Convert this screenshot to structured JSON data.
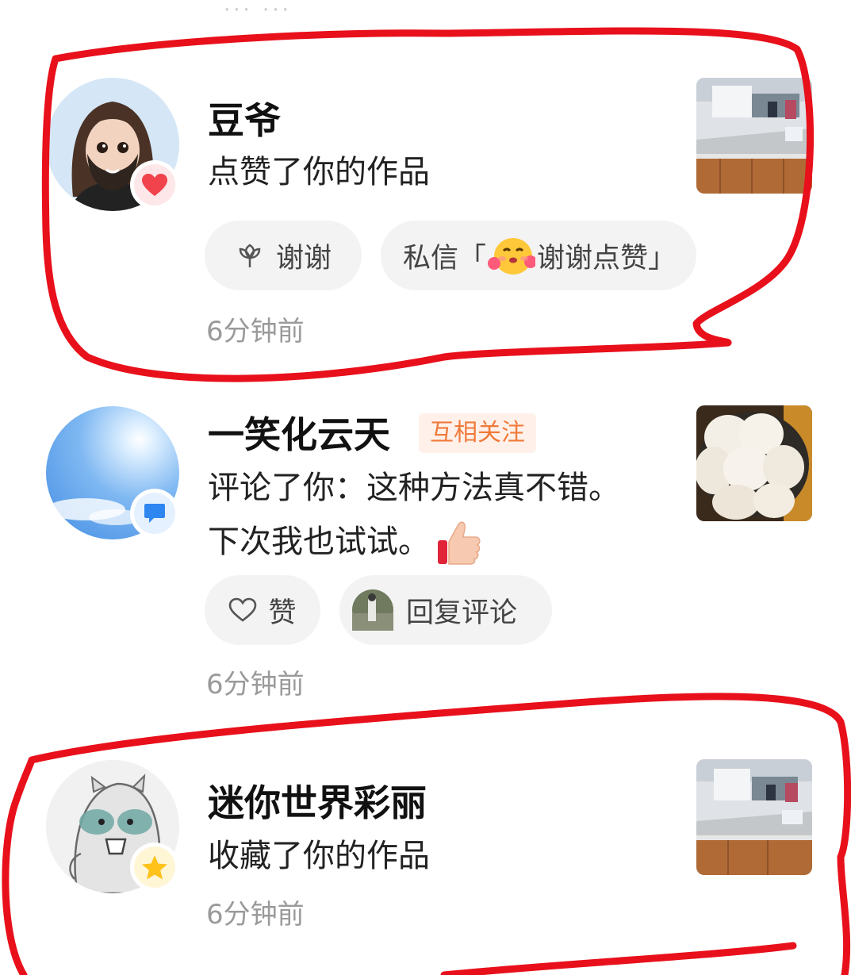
{
  "top_cut_text": "··· ···",
  "notifications": [
    {
      "name": "豆爷",
      "action": "点赞了你的作品",
      "time": "6分钟前",
      "badge_icon": "heart-icon",
      "buttons": [
        {
          "label": "谢谢",
          "icon": "flower-icon"
        },
        {
          "label_prefix": "私信「",
          "emoji": "blushing-hug-emoji",
          "label_suffix": "谢谢点赞」"
        }
      ]
    },
    {
      "name": "一笑化云天",
      "tag": "互相关注",
      "comment_line1": "评论了你：这种方法真不错。",
      "comment_line2": "下次我也试试。",
      "comment_emoji": "thumbs-up-emoji",
      "time": "6分钟前",
      "badge_icon": "comment-icon",
      "buttons": [
        {
          "label": "赞",
          "icon": "heart-outline-icon"
        },
        {
          "label": "回复评论",
          "icon": "mini-avatar"
        }
      ]
    },
    {
      "name": "迷你世界彩丽",
      "action": "收藏了你的作品",
      "time": "6分钟前",
      "badge_icon": "star-icon"
    }
  ],
  "colors": {
    "annotation_red": "#e8101b",
    "heart_red": "#f0434c",
    "comment_blue": "#2e86f0",
    "star_gold": "#ffc21a",
    "tag_orange": "#f07a3a",
    "chip_bg": "#f3f3f3",
    "time_gray": "#9a9a9a"
  }
}
